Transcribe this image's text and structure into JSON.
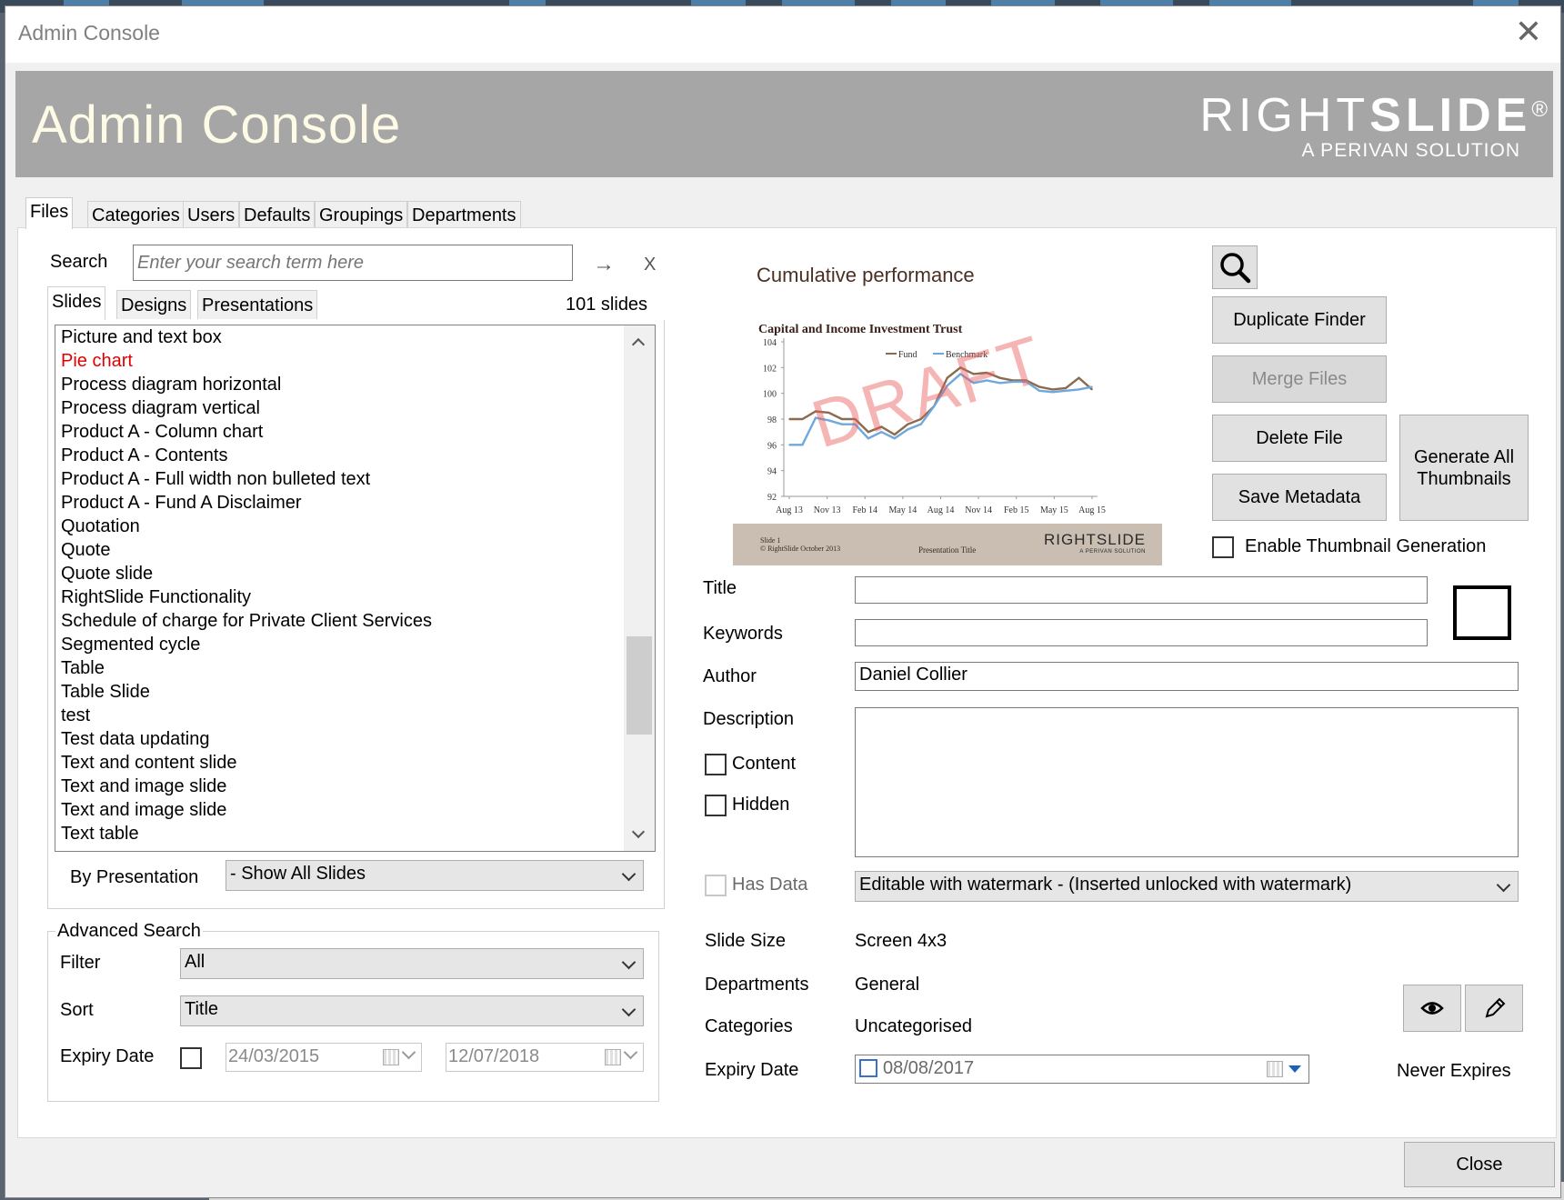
{
  "window": {
    "title": "Admin Console",
    "close_glyph": "✕"
  },
  "banner": {
    "title": "Admin Console",
    "logo_right": "RIGHT",
    "logo_slide": "SLIDE",
    "logo_reg": "®",
    "logo_tagline": "A PERIVAN SOLUTION"
  },
  "tabs": [
    {
      "label": "Files",
      "active": true
    },
    {
      "label": "Categories"
    },
    {
      "label": "Users"
    },
    {
      "label": "Defaults"
    },
    {
      "label": "Groupings"
    },
    {
      "label": "Departments"
    }
  ],
  "search": {
    "label": "Search",
    "placeholder": "Enter your search term here",
    "go_glyph": "→",
    "clear_glyph": "X"
  },
  "subtabs": [
    {
      "label": "Slides",
      "active": true
    },
    {
      "label": "Designs"
    },
    {
      "label": "Presentations"
    }
  ],
  "slide_count": "101 slides",
  "slides": [
    {
      "label": "Picture and text box"
    },
    {
      "label": "Pie chart",
      "highlight": true
    },
    {
      "label": "Process diagram horizontal"
    },
    {
      "label": "Process diagram vertical"
    },
    {
      "label": "Product A - Column chart"
    },
    {
      "label": "Product A - Contents"
    },
    {
      "label": "Product A - Full width non bulleted text"
    },
    {
      "label": "Product A - Fund A Disclaimer"
    },
    {
      "label": "Quotation"
    },
    {
      "label": "Quote"
    },
    {
      "label": "Quote slide"
    },
    {
      "label": "RightSlide Functionality"
    },
    {
      "label": "Schedule of charge for Private Client Services"
    },
    {
      "label": "Segmented cycle"
    },
    {
      "label": "Table"
    },
    {
      "label": "Table Slide"
    },
    {
      "label": "test"
    },
    {
      "label": "Test data updating"
    },
    {
      "label": "Text and content slide"
    },
    {
      "label": "Text and image slide"
    },
    {
      "label": "Text and image slide"
    },
    {
      "label": "Text table"
    }
  ],
  "by_presentation": {
    "label": "By Presentation",
    "value": "- Show All Slides"
  },
  "advanced": {
    "title": "Advanced Search",
    "filter_label": "Filter",
    "filter_value": "All",
    "sort_label": "Sort",
    "sort_value": "Title",
    "expiry_label": "Expiry Date",
    "date_from": "24/03/2015",
    "date_to": "12/07/2018"
  },
  "preview": {
    "slide_title": "Cumulative performance",
    "chart_title": "Capital and Income Investment Trust",
    "watermark": "DRAFT",
    "footer_slide": "Slide 1",
    "footer_copyright": "© RightSlide October 2013",
    "footer_presentation": "Presentation Title",
    "footer_logo": "RIGHTSLIDE",
    "footer_tagline": "A PERIVAN SOLUTION"
  },
  "chart_data": {
    "type": "line",
    "title": "Capital and Income Investment Trust",
    "x_tick_labels": [
      "Aug 13",
      "Nov 13",
      "Feb 14",
      "May 14",
      "Aug 14",
      "Nov 14",
      "Feb 15",
      "May 15",
      "Aug 15"
    ],
    "y_ticks": [
      92,
      94,
      96,
      98,
      100,
      102,
      104
    ],
    "ylim": [
      92,
      104
    ],
    "legend_position": "top",
    "series": [
      {
        "name": "Fund",
        "color": "#8b6b4e",
        "values": [
          98,
          98,
          98.6,
          98.5,
          98,
          98,
          97,
          97.4,
          96.8,
          97.6,
          98,
          99,
          101.2,
          102,
          101.5,
          101.6,
          101.2,
          101,
          101,
          100.5,
          100.3,
          100.4,
          101.2,
          100.3
        ]
      },
      {
        "name": "Benchmark",
        "color": "#6fa8dc",
        "values": [
          96,
          96,
          98.1,
          97.9,
          97.6,
          97.6,
          96.5,
          97,
          96.5,
          97.2,
          97.6,
          99,
          100.6,
          101.5,
          100.8,
          101,
          100.8,
          100.9,
          100.9,
          100.2,
          100.1,
          100.2,
          100.3,
          100.5
        ]
      }
    ]
  },
  "actions": {
    "duplicate": "Duplicate Finder",
    "merge": "Merge Files",
    "delete": "Delete File",
    "generate": "Generate All Thumbnails",
    "save": "Save Metadata",
    "enable_thumbs": "Enable Thumbnail Generation"
  },
  "meta": {
    "title_label": "Title",
    "title_value": "",
    "keywords_label": "Keywords",
    "keywords_value": "",
    "author_label": "Author",
    "author_value": "Daniel Collier",
    "description_label": "Description",
    "description_value": "",
    "content_label": "Content",
    "hidden_label": "Hidden",
    "hasdata_label": "Has Data",
    "lock_value": "Editable with watermark - (Inserted unlocked with watermark)",
    "slidesize_label": "Slide Size",
    "slidesize_value": "Screen 4x3",
    "departments_label": "Departments",
    "departments_value": "General",
    "categories_label": "Categories",
    "categories_value": "Uncategorised",
    "expiry_label": "Expiry Date",
    "expiry_value": "08/08/2017",
    "never_expires": "Never Expires"
  },
  "close_button": "Close",
  "icons": {
    "magnifier": "search-icon",
    "eye": "eye-icon",
    "pencil": "pencil-icon",
    "color": "color-swatch"
  }
}
